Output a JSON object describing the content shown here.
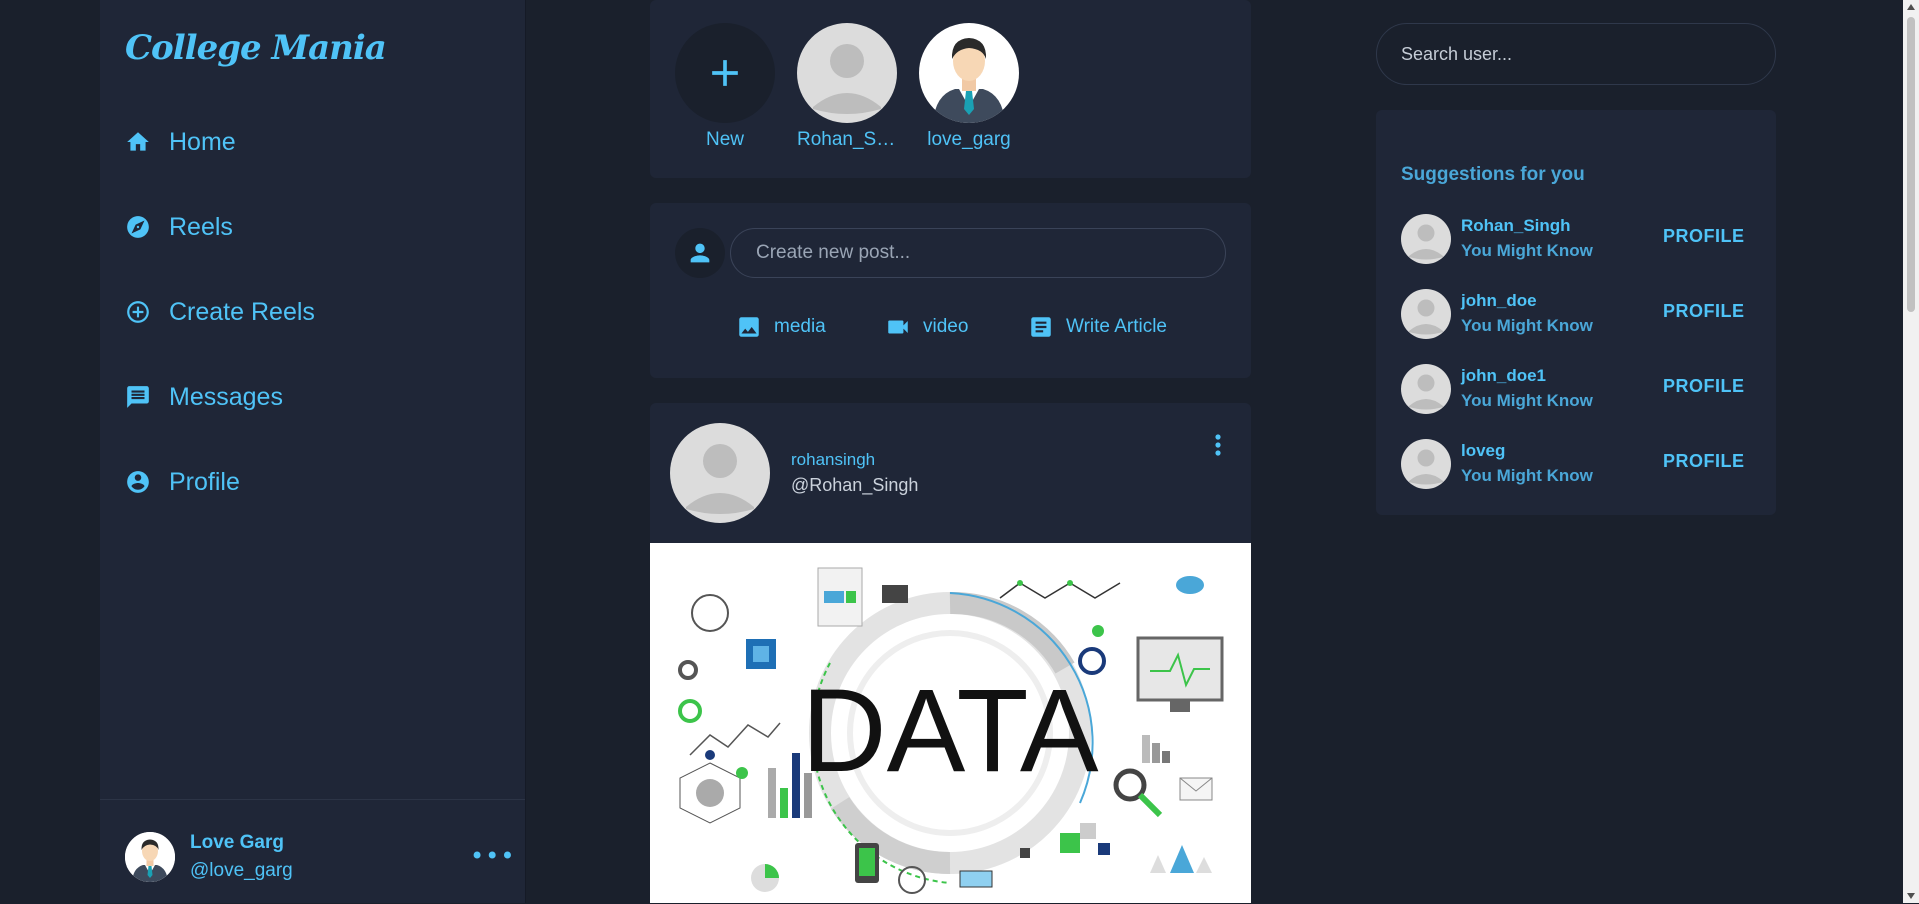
{
  "app": {
    "logo": "College Mania"
  },
  "nav": {
    "items": [
      {
        "label": "Home",
        "icon": "home-icon"
      },
      {
        "label": "Reels",
        "icon": "compass-icon"
      },
      {
        "label": "Create Reels",
        "icon": "add-circle-icon"
      },
      {
        "label": "Messages",
        "icon": "message-icon"
      },
      {
        "label": "Profile",
        "icon": "account-circle-icon"
      }
    ]
  },
  "current_user": {
    "name": "Love Garg",
    "handle": "@love_garg",
    "more": "•••"
  },
  "stories": [
    {
      "label": "New",
      "icon": "plus-icon"
    },
    {
      "label": "Rohan_Sin...",
      "icon": "default-avatar-icon"
    },
    {
      "label": "love_garg",
      "icon": "businessman-avatar-icon"
    }
  ],
  "create_post": {
    "placeholder": "Create new post...",
    "actions": [
      {
        "label": "media",
        "icon": "image-icon"
      },
      {
        "label": "video",
        "icon": "videocam-icon"
      },
      {
        "label": "Write Article",
        "icon": "article-icon"
      }
    ]
  },
  "post": {
    "name": "rohansingh",
    "handle": "@Rohan_Singh",
    "image_text": "DATA"
  },
  "search": {
    "placeholder": "Search user..."
  },
  "suggestions": {
    "title": "Suggestions for you",
    "button_label": "PROFILE",
    "items": [
      {
        "name": "Rohan_Singh",
        "sub": "You Might Know"
      },
      {
        "name": "john_doe",
        "sub": "You Might Know"
      },
      {
        "name": "john_doe1",
        "sub": "You Might Know"
      },
      {
        "name": "loveg",
        "sub": "You Might Know"
      }
    ]
  },
  "colors": {
    "background": "#1a202c",
    "panel": "#1f2637",
    "accent": "#4fc3f7"
  }
}
